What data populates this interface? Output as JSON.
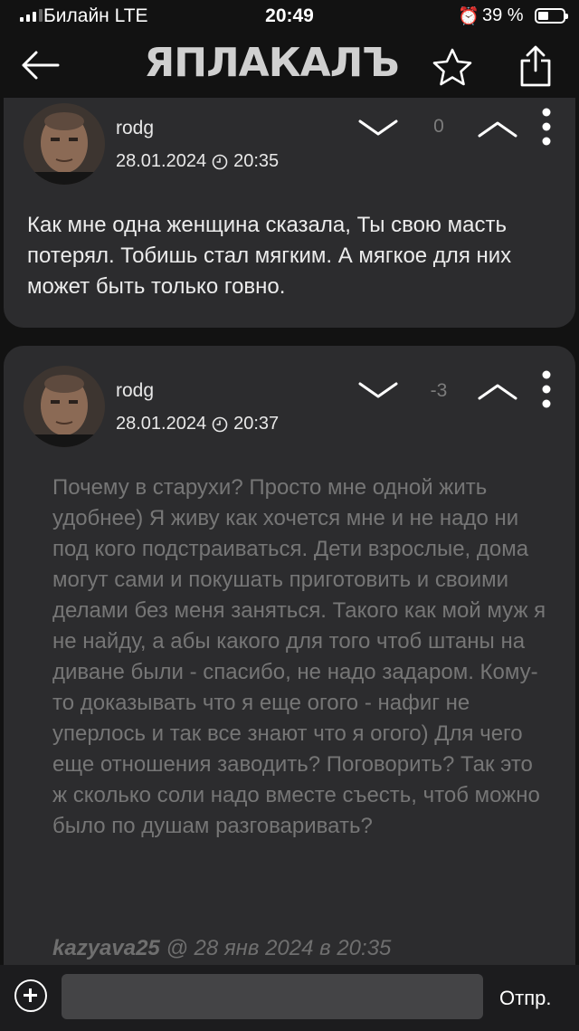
{
  "status_bar": {
    "carrier": "Билайн  LTE",
    "time": "20:49",
    "battery": "39 %"
  },
  "nav": {
    "logo": "ЯПЛАКАЛЪ"
  },
  "comments": [
    {
      "username": "rodg",
      "date": "28.01.2024",
      "time": "20:35",
      "score": "0",
      "text": "Как мне одна женщина сказала, Ты свою масть потерял. Тобишь стал мягким. А мягкое для них может быть только говно."
    },
    {
      "username": "rodg",
      "date": "28.01.2024",
      "time": "20:37",
      "score": "-3",
      "quote_text": "Почему в старухи? Просто мне одной жить удобнее) Я живу как хочется мне и не надо ни под кого подстраиваться. Дети взрослые, дома могут сами и покушать приготовить и своими делами без меня заняться. Такого как мой муж я не найду, а абы какого для того чтоб штаны на диване были - спасибо, не надо задаром. Кому-то доказывать что я еще огого - нафиг не уперлось и так все знают что я огого) Для чего еще отношения заводить? Поговорить? Так это ж сколько соли надо вместе съесть, чтоб можно было по душам разговаривать?",
      "quote_author": "kazyava25",
      "quote_sep": " @ ",
      "quote_date": "28 янв 2024 в 20:35"
    }
  ],
  "compose": {
    "input_value": "",
    "placeholder": "",
    "send_label": "Отпр."
  },
  "colors": {
    "background": "#121212",
    "card": "#2c2c2e",
    "muted_text": "#767676"
  }
}
